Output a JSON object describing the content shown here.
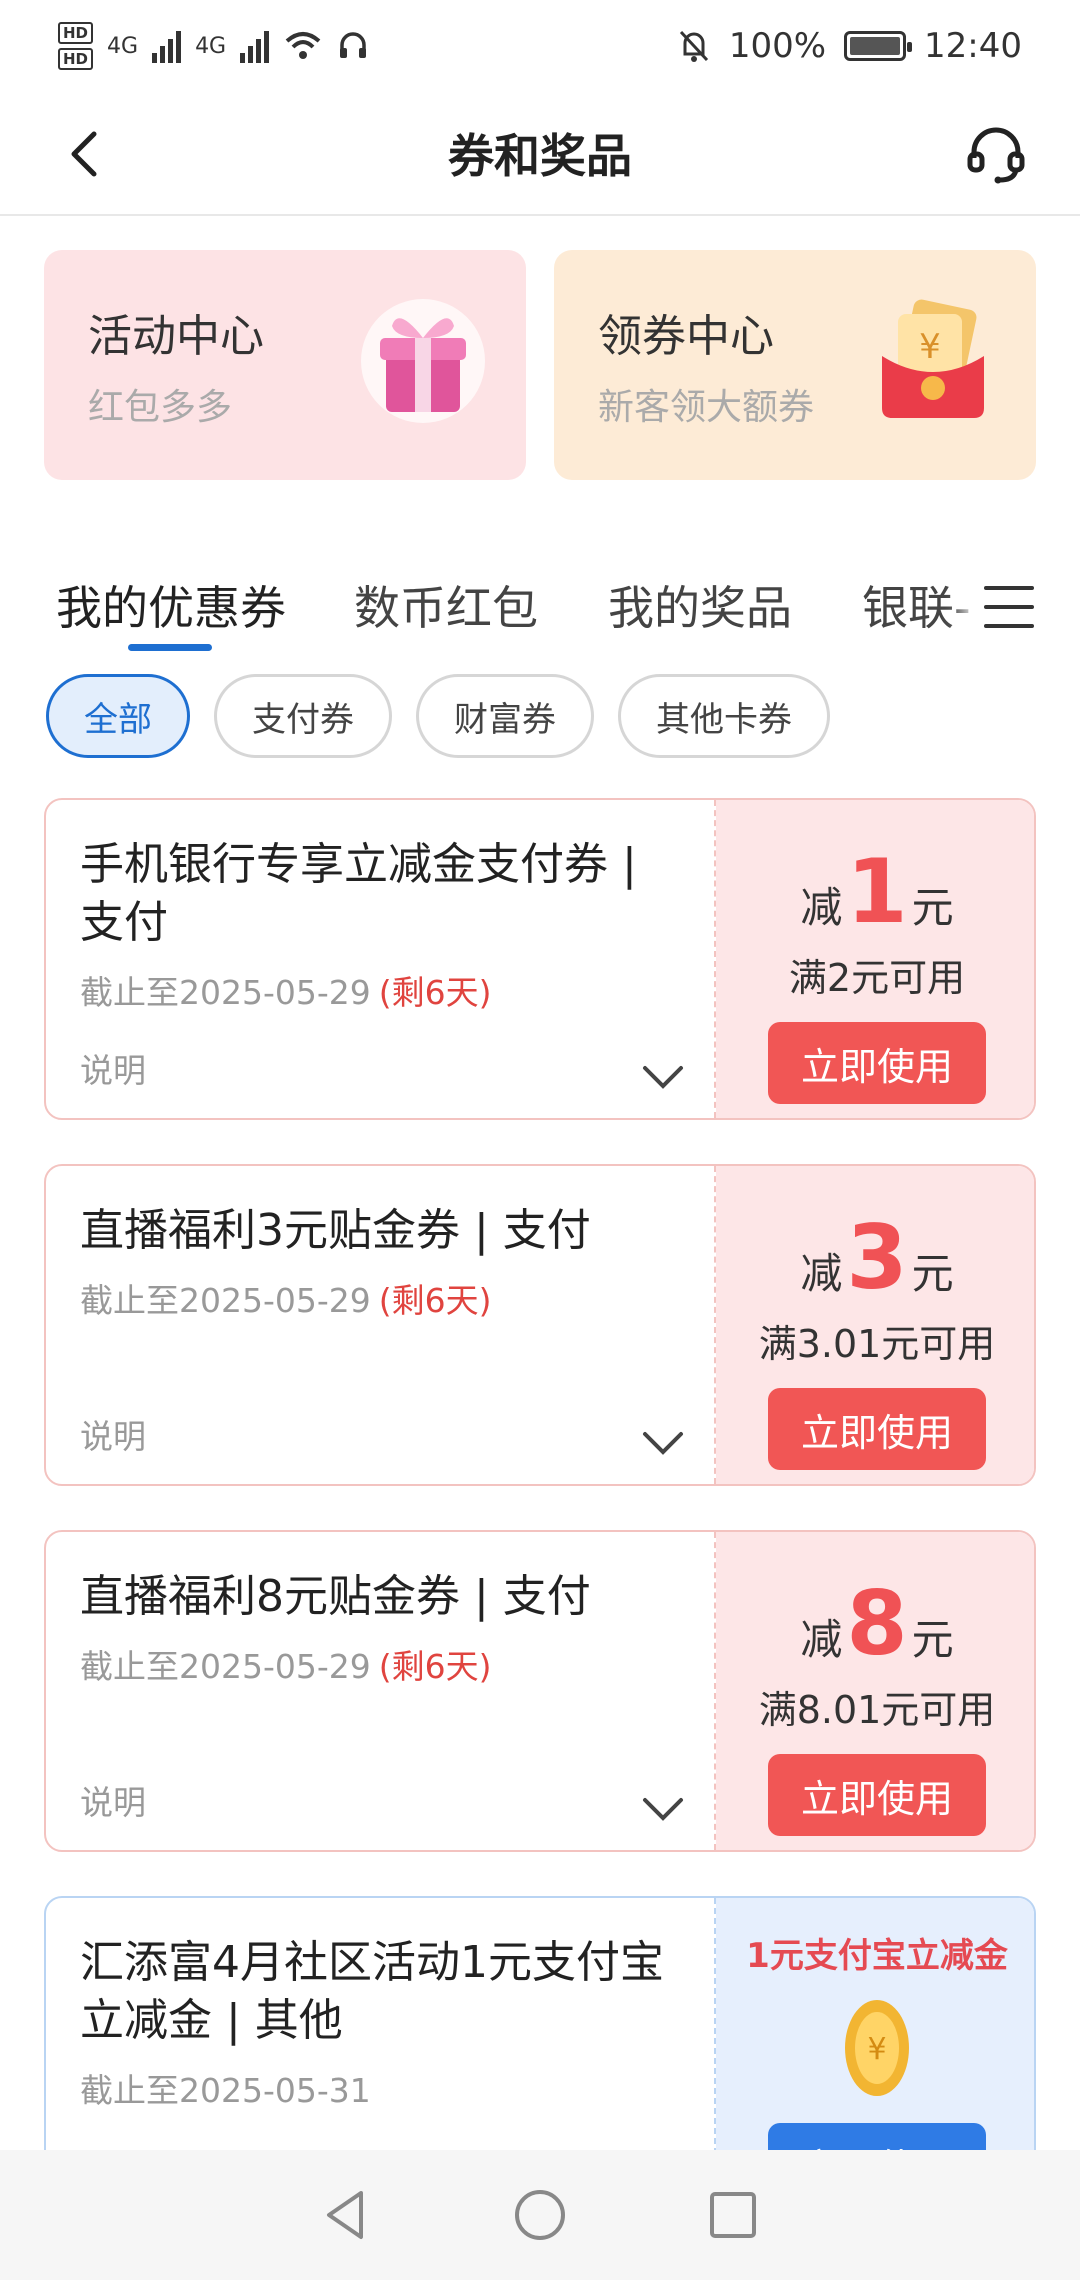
{
  "status_bar": {
    "hd1": "HD",
    "hd2": "HD",
    "net1": "4G",
    "net2": "4G",
    "battery": "100%",
    "time": "12:40"
  },
  "header": {
    "title": "券和奖品"
  },
  "promos": [
    {
      "title": "活动中心",
      "subtitle": "红包多多"
    },
    {
      "title": "领券中心",
      "subtitle": "新客领大额券"
    }
  ],
  "tabs": [
    "我的优惠券",
    "数币红包",
    "我的奖品",
    "银联-"
  ],
  "filters": [
    "全部",
    "支付券",
    "财富券",
    "其他卡券"
  ],
  "coupons": [
    {
      "name": "手机银行专享立减金支付券 | 支付",
      "expiry": "截止至2025-05-29",
      "remaining": "(剩6天)",
      "desc": "说明",
      "prefix": "减",
      "amount": "1",
      "unit": "元",
      "condition": "满2元可用",
      "button": "立即使用"
    },
    {
      "name": "直播福利3元贴金券 | 支付",
      "expiry": "截止至2025-05-29",
      "remaining": "(剩6天)",
      "desc": "说明",
      "prefix": "减",
      "amount": "3",
      "unit": "元",
      "condition": "满3.01元可用",
      "button": "立即使用"
    },
    {
      "name": "直播福利8元贴金券 | 支付",
      "expiry": "截止至2025-05-29",
      "remaining": "(剩6天)",
      "desc": "说明",
      "prefix": "减",
      "amount": "8",
      "unit": "元",
      "condition": "满8.01元可用",
      "button": "立即使用"
    },
    {
      "name": "汇添富4月社区活动1元支付宝立减金 | 其他",
      "expiry": "截止至2025-05-31",
      "label": "1元支付宝立减金",
      "button": "立即使用"
    }
  ],
  "colors": {
    "accent_blue": "#1e6fd1",
    "coupon_red": "#f05255",
    "button_red": "#f15655",
    "button_blue": "#2f7be5"
  },
  "icons": [
    "back-icon",
    "customer-service-icon",
    "gift-box-icon",
    "red-envelope-icon",
    "menu-icon",
    "chevron-down-icon",
    "gold-coin-icon",
    "nav-back-icon",
    "nav-home-icon",
    "nav-recent-icon"
  ]
}
